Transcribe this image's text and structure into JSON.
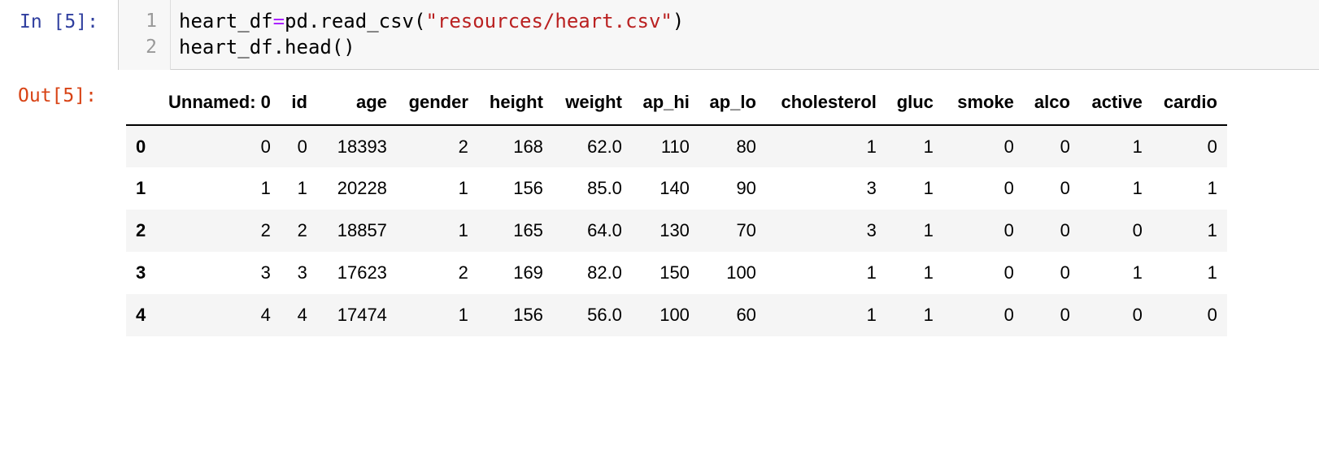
{
  "input_cell": {
    "prompt": "In [5]:",
    "line_numbers": [
      "1",
      "2"
    ],
    "lines": [
      {
        "var": "heart_df",
        "op": "=",
        "call": "pd.read_csv(",
        "str": "\"resources/heart.csv\"",
        "close": ")"
      },
      {
        "text": "heart_df.head()"
      }
    ]
  },
  "output_cell": {
    "prompt": "Out[5]:",
    "table": {
      "columns": [
        "",
        "Unnamed: 0",
        "id",
        "age",
        "gender",
        "height",
        "weight",
        "ap_hi",
        "ap_lo",
        "cholesterol",
        "gluc",
        "smoke",
        "alco",
        "active",
        "cardio"
      ],
      "rows": [
        [
          "0",
          "0",
          "0",
          "18393",
          "2",
          "168",
          "62.0",
          "110",
          "80",
          "1",
          "1",
          "0",
          "0",
          "1",
          "0"
        ],
        [
          "1",
          "1",
          "1",
          "20228",
          "1",
          "156",
          "85.0",
          "140",
          "90",
          "3",
          "1",
          "0",
          "0",
          "1",
          "1"
        ],
        [
          "2",
          "2",
          "2",
          "18857",
          "1",
          "165",
          "64.0",
          "130",
          "70",
          "3",
          "1",
          "0",
          "0",
          "0",
          "1"
        ],
        [
          "3",
          "3",
          "3",
          "17623",
          "2",
          "169",
          "82.0",
          "150",
          "100",
          "1",
          "1",
          "0",
          "0",
          "1",
          "1"
        ],
        [
          "4",
          "4",
          "4",
          "17474",
          "1",
          "156",
          "56.0",
          "100",
          "60",
          "1",
          "1",
          "0",
          "0",
          "0",
          "0"
        ]
      ]
    }
  }
}
